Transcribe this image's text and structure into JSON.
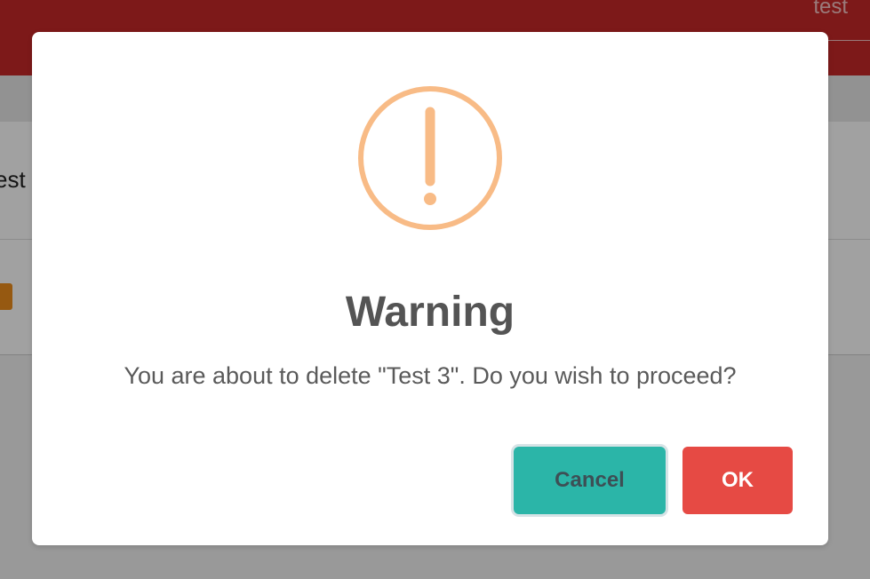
{
  "header": {
    "user_label": "test"
  },
  "background": {
    "card_row_text": "est"
  },
  "dialog": {
    "icon": "exclamation-circle-icon",
    "title": "Warning",
    "message": "You are about to delete \"Test 3\". Do you wish to proceed?",
    "cancel_label": "Cancel",
    "ok_label": "OK"
  },
  "colors": {
    "header_bg": "#c62828",
    "icon_color": "#f8bb86",
    "cancel_bg": "#2bb5a8",
    "ok_bg": "#e64a44",
    "title_color": "#545454"
  }
}
